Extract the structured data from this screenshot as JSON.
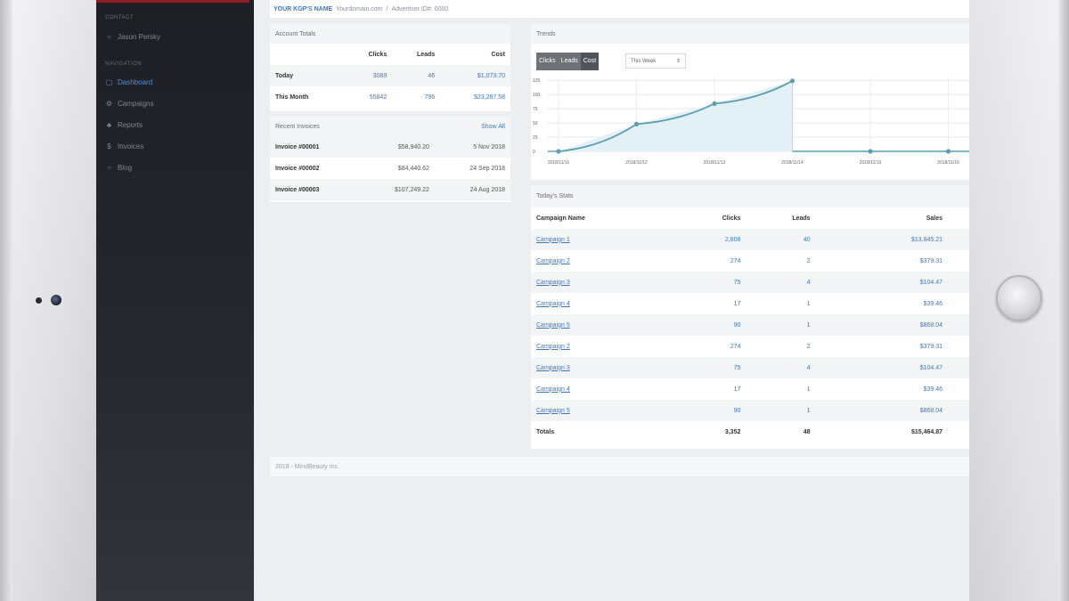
{
  "topbar": {
    "brand": "YOUR KGP'S NAME",
    "domain": "Yourdomain.com",
    "sep": "/",
    "advertiser": "Advertiser ID#: 0000"
  },
  "sidebar": {
    "contact_heading": "CONTACT",
    "contact_name": "Jason Persky",
    "nav_heading": "NAVIGATION",
    "items": [
      {
        "label": "Dashboard",
        "icon": "dashboard-icon",
        "active": true
      },
      {
        "label": "Campaigns",
        "icon": "campaigns-icon",
        "active": false
      },
      {
        "label": "Reports",
        "icon": "reports-icon",
        "active": false
      },
      {
        "label": "Invoices",
        "icon": "invoices-icon",
        "active": false
      },
      {
        "label": "Blog",
        "icon": "blog-icon",
        "active": false
      }
    ]
  },
  "account_totals": {
    "title": "Account Totals",
    "headers": [
      "",
      "Clicks",
      "Leads",
      "Cost"
    ],
    "rows": [
      {
        "label": "Today",
        "clicks": "3089",
        "leads": "46",
        "cost": "$1,073.70"
      },
      {
        "label": "This Month",
        "clicks": "55842",
        "leads": "796",
        "cost": "$23,287.58"
      }
    ]
  },
  "recent_invoices": {
    "title": "Recent Invoices",
    "show_all": "Show All",
    "rows": [
      {
        "name": "Invoice #00001",
        "amount": "$58,940.20",
        "date": "5 Nov 2018"
      },
      {
        "name": "Invoice #00002",
        "amount": "$84,440.62",
        "date": "24 Sep 2018"
      },
      {
        "name": "Invoice #00003",
        "amount": "$107,249.22",
        "date": "24 Aug 2018"
      }
    ]
  },
  "trends": {
    "title": "Trends",
    "toggles": [
      "Clicks",
      "Leads",
      "Cost"
    ],
    "selected_toggle": "Cost",
    "range": "This Week",
    "range_caret": "⇕"
  },
  "chart_data": {
    "type": "area",
    "x": [
      "2018/11/11",
      "2018/11/12",
      "2018/11/13",
      "2018/11/14",
      "2018/11/15",
      "2018/11/16"
    ],
    "series": [
      {
        "values": [
          0,
          48,
          84,
          124,
          0,
          0
        ]
      }
    ],
    "ylim": [
      0,
      130
    ],
    "yticks": [
      0,
      25,
      50,
      75,
      100,
      125
    ],
    "ytick_labels": [
      "0",
      "25",
      "50",
      "75",
      "100",
      "125"
    ],
    "grid": true,
    "fill_color": "#e3f0f5",
    "line_color": "#5a9fb2"
  },
  "todays_stats": {
    "title": "Today's Stats",
    "headers": [
      "Campaign Name",
      "Clicks",
      "Leads",
      "Sales"
    ],
    "rows": [
      {
        "name": "Campaign 1",
        "clicks": "2,806",
        "leads": "40",
        "sales": "$13,845.21"
      },
      {
        "name": "Campaign 2",
        "clicks": "274",
        "leads": "2",
        "sales": "$379.31"
      },
      {
        "name": "Campaign 3",
        "clicks": "75",
        "leads": "4",
        "sales": "$104.47"
      },
      {
        "name": "Campaign 4",
        "clicks": "17",
        "leads": "1",
        "sales": "$39.46"
      },
      {
        "name": "Campaign 5",
        "clicks": "90",
        "leads": "1",
        "sales": "$868.04"
      },
      {
        "name": "Campaign 2",
        "clicks": "274",
        "leads": "2",
        "sales": "$379.31"
      },
      {
        "name": "Campaign 3",
        "clicks": "75",
        "leads": "4",
        "sales": "$104.47"
      },
      {
        "name": "Campaign 4",
        "clicks": "17",
        "leads": "1",
        "sales": "$39.46"
      },
      {
        "name": "Campaign 5",
        "clicks": "90",
        "leads": "1",
        "sales": "$868.04"
      }
    ],
    "totals": {
      "label": "Totals",
      "clicks": "3,352",
      "leads": "48",
      "sales": "$15,464.87"
    }
  },
  "footer": {
    "text": "2018 - MindBeauty Inc."
  }
}
